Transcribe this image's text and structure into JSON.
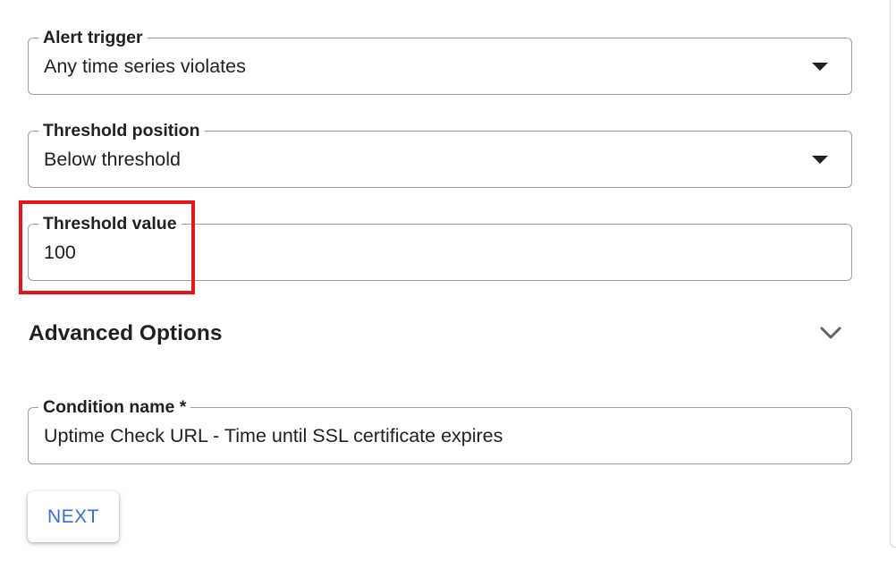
{
  "form": {
    "alert_trigger": {
      "label": "Alert trigger",
      "value": "Any time series violates",
      "icon": "dropdown-arrow-icon"
    },
    "threshold_position": {
      "label": "Threshold position",
      "value": "Below threshold",
      "icon": "dropdown-arrow-icon"
    },
    "threshold_value": {
      "label": "Threshold value",
      "value": "100"
    },
    "advanced_options": {
      "title": "Advanced Options",
      "icon": "chevron-down-icon"
    },
    "condition_name": {
      "label": "Condition name *",
      "value": "Uptime Check URL - Time until SSL certificate expires"
    },
    "next_button": {
      "label": "NEXT"
    }
  },
  "colors": {
    "highlight": "#e8141b",
    "accent": "#3a6fd8",
    "border": "#9aa0a6",
    "text": "#202124"
  }
}
